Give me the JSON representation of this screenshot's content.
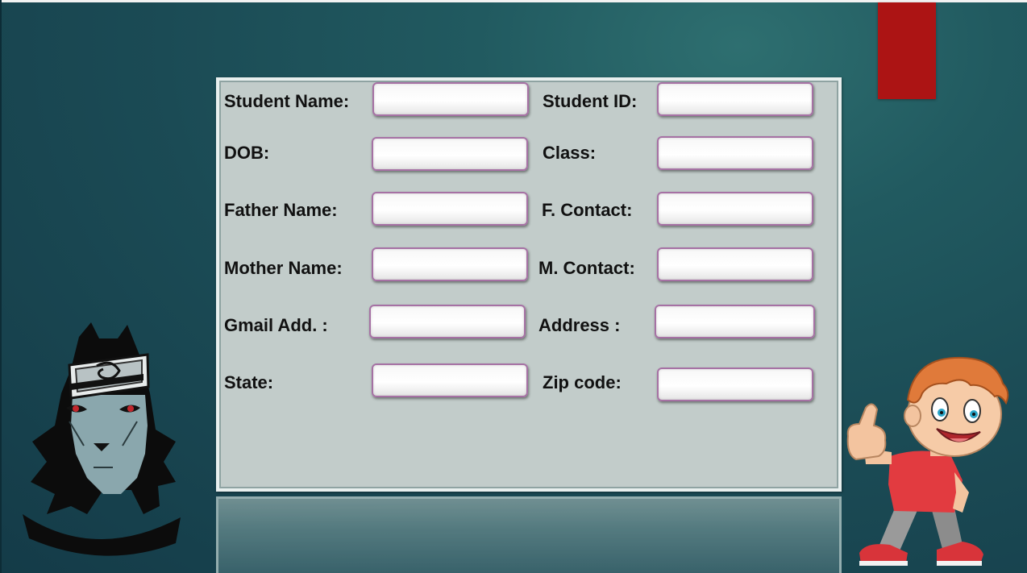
{
  "form": {
    "student_name_label": "Student Name:",
    "student_id_label": "Student ID:",
    "dob_label": "DOB:",
    "class_label": "Class:",
    "father_name_label": "Father Name:",
    "f_contact_label": "F. Contact:",
    "mother_name_label": "Mother Name:",
    "m_contact_label": "M. Contact:",
    "gmail_label": "Gmail Add. :",
    "address_label": "Address :",
    "state_label": "State:",
    "zip_label": "Zip code:",
    "student_name_value": "",
    "student_id_value": "",
    "dob_value": "",
    "class_value": "",
    "father_name_value": "",
    "f_contact_value": "",
    "mother_name_value": "",
    "m_contact_value": "",
    "gmail_value": "",
    "address_value": "",
    "state_value": "",
    "zip_value": ""
  },
  "colors": {
    "background": "#1b4b55",
    "panel": "#c2ccca",
    "field_border": "#a671a4",
    "bookmark": "#ac1414"
  },
  "decorations": {
    "left_image": "anime-character-face",
    "right_image": "cartoon-boy-thumbs-up"
  }
}
